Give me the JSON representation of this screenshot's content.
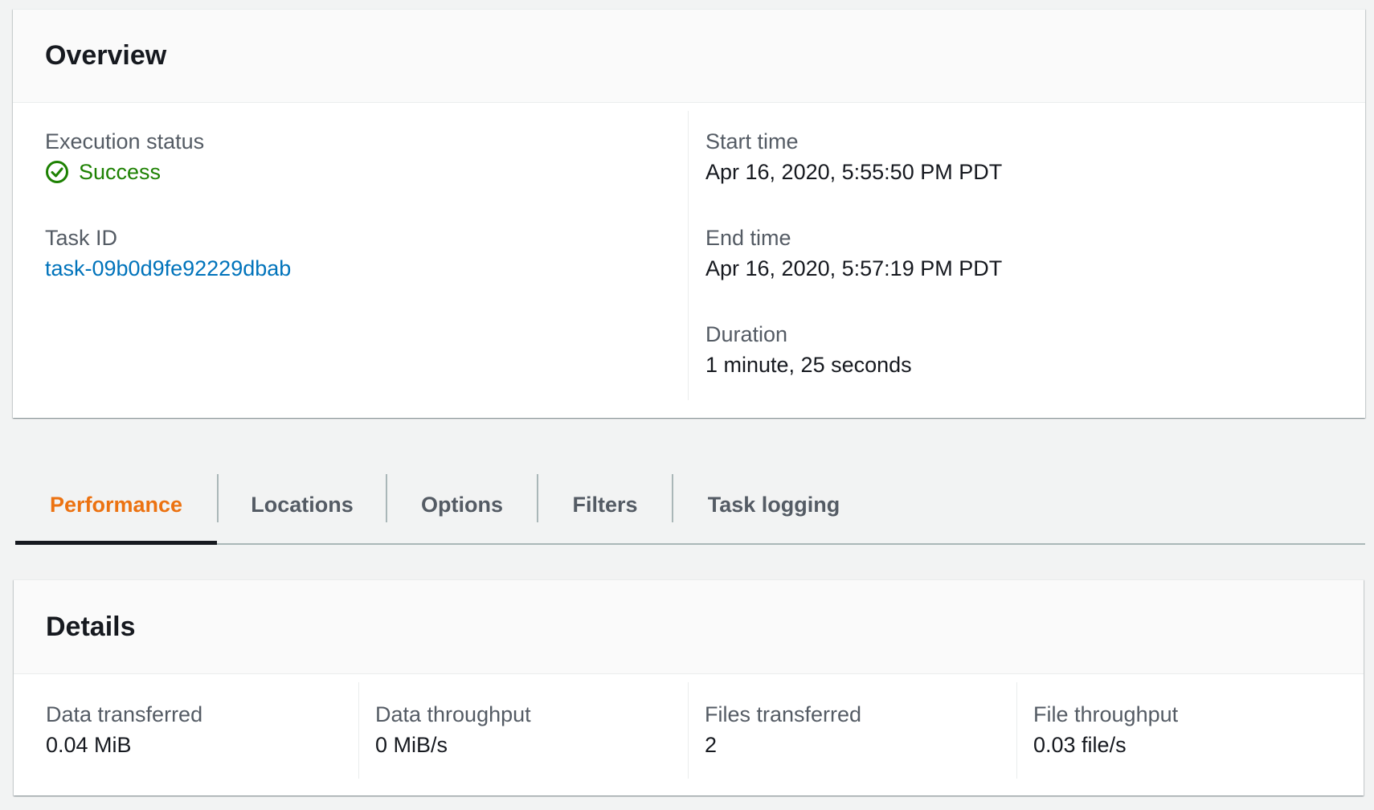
{
  "overview": {
    "title": "Overview",
    "execution_status_label": "Execution status",
    "execution_status_value": "Success",
    "task_id_label": "Task ID",
    "task_id_value": "task-09b0d9fe92229dbab",
    "start_time_label": "Start time",
    "start_time_value": "Apr 16, 2020, 5:55:50 PM PDT",
    "end_time_label": "End time",
    "end_time_value": "Apr 16, 2020, 5:57:19 PM PDT",
    "duration_label": "Duration",
    "duration_value": "1 minute, 25 seconds"
  },
  "tabs": [
    {
      "label": "Performance",
      "active": true
    },
    {
      "label": "Locations",
      "active": false
    },
    {
      "label": "Options",
      "active": false
    },
    {
      "label": "Filters",
      "active": false
    },
    {
      "label": "Task logging",
      "active": false
    }
  ],
  "details": {
    "title": "Details",
    "items": [
      {
        "label": "Data transferred",
        "value": "0.04 MiB"
      },
      {
        "label": "Data throughput",
        "value": "0 MiB/s"
      },
      {
        "label": "Files transferred",
        "value": "2"
      },
      {
        "label": "File throughput",
        "value": "0.03 file/s"
      }
    ]
  },
  "colors": {
    "success": "#1d8102",
    "link": "#0073bb",
    "active_tab": "#ec7211"
  },
  "icons": {
    "status": "check-circle-icon"
  }
}
